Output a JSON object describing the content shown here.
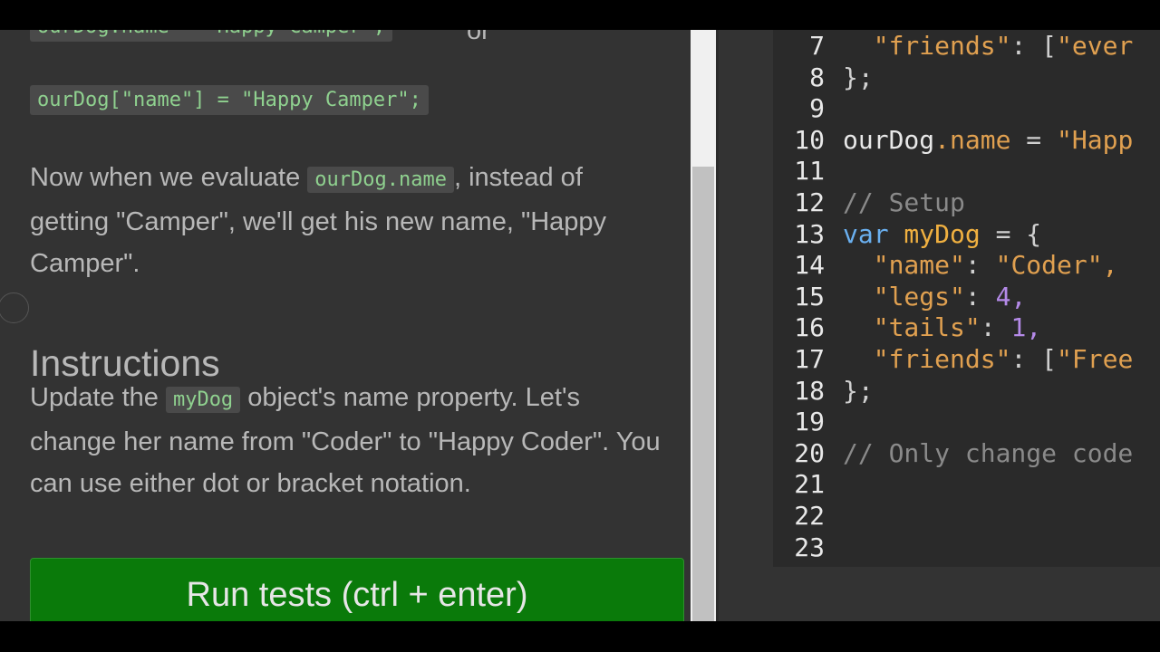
{
  "lesson": {
    "snippet_top": "ourDog.name = \"Happy Camper\";",
    "snippet_top_suffix": "or",
    "snippet_bracket": "ourDog[\"name\"] = \"Happy Camper\";",
    "para1_a": "Now when we evaluate ",
    "para1_code": "ourDog.name",
    "para1_b": ", instead of getting \"Camper\", we'll get his new name, \"Happy Camper\".",
    "instructions_heading": "Instructions",
    "para2_a": "Update the ",
    "para2_code": "myDog",
    "para2_b": " object's name property. Let's change her name from \"Coder\" to \"Happy Coder\". You can use either dot or bracket notation.",
    "run_button": "Run tests (ctrl + enter)"
  },
  "editor": {
    "lines": [
      {
        "n": "7",
        "t1": "  ",
        "t2": "\"friends\"",
        "t3": ": [",
        "t4": "\"ever"
      },
      {
        "n": "8",
        "t1": "};",
        "t2": "",
        "t3": "",
        "t4": ""
      },
      {
        "n": "9",
        "t1": "",
        "t2": "",
        "t3": "",
        "t4": ""
      },
      {
        "n": "10",
        "t1": "ourDog",
        "t2": ".name",
        "t3": " = ",
        "t4": "\"Happ"
      },
      {
        "n": "11",
        "t1": "",
        "t2": "",
        "t3": "",
        "t4": ""
      },
      {
        "n": "12",
        "t1": "// Setup",
        "t2": "",
        "t3": "",
        "t4": ""
      },
      {
        "n": "13",
        "t1": "var",
        "t2": " myDog",
        "t3": " = {",
        "t4": ""
      },
      {
        "n": "14",
        "t1": "  ",
        "t2": "\"name\"",
        "t3": ": ",
        "t4": "\"Coder\","
      },
      {
        "n": "15",
        "t1": "  ",
        "t2": "\"legs\"",
        "t3": ": ",
        "t4": "4,"
      },
      {
        "n": "16",
        "t1": "  ",
        "t2": "\"tails\"",
        "t3": ": ",
        "t4": "1,"
      },
      {
        "n": "17",
        "t1": "  ",
        "t2": "\"friends\"",
        "t3": ": [",
        "t4": "\"Free"
      },
      {
        "n": "18",
        "t1": "};",
        "t2": "",
        "t3": "",
        "t4": ""
      },
      {
        "n": "19",
        "t1": "",
        "t2": "",
        "t3": "",
        "t4": ""
      },
      {
        "n": "20",
        "t1": "// Only change code",
        "t2": "",
        "t3": "",
        "t4": ""
      },
      {
        "n": "21",
        "t1": "",
        "t2": "",
        "t3": "",
        "t4": ""
      },
      {
        "n": "22",
        "t1": "",
        "t2": "",
        "t3": "",
        "t4": ""
      },
      {
        "n": "23",
        "t1": "",
        "t2": "",
        "t3": "",
        "t4": ""
      }
    ]
  }
}
